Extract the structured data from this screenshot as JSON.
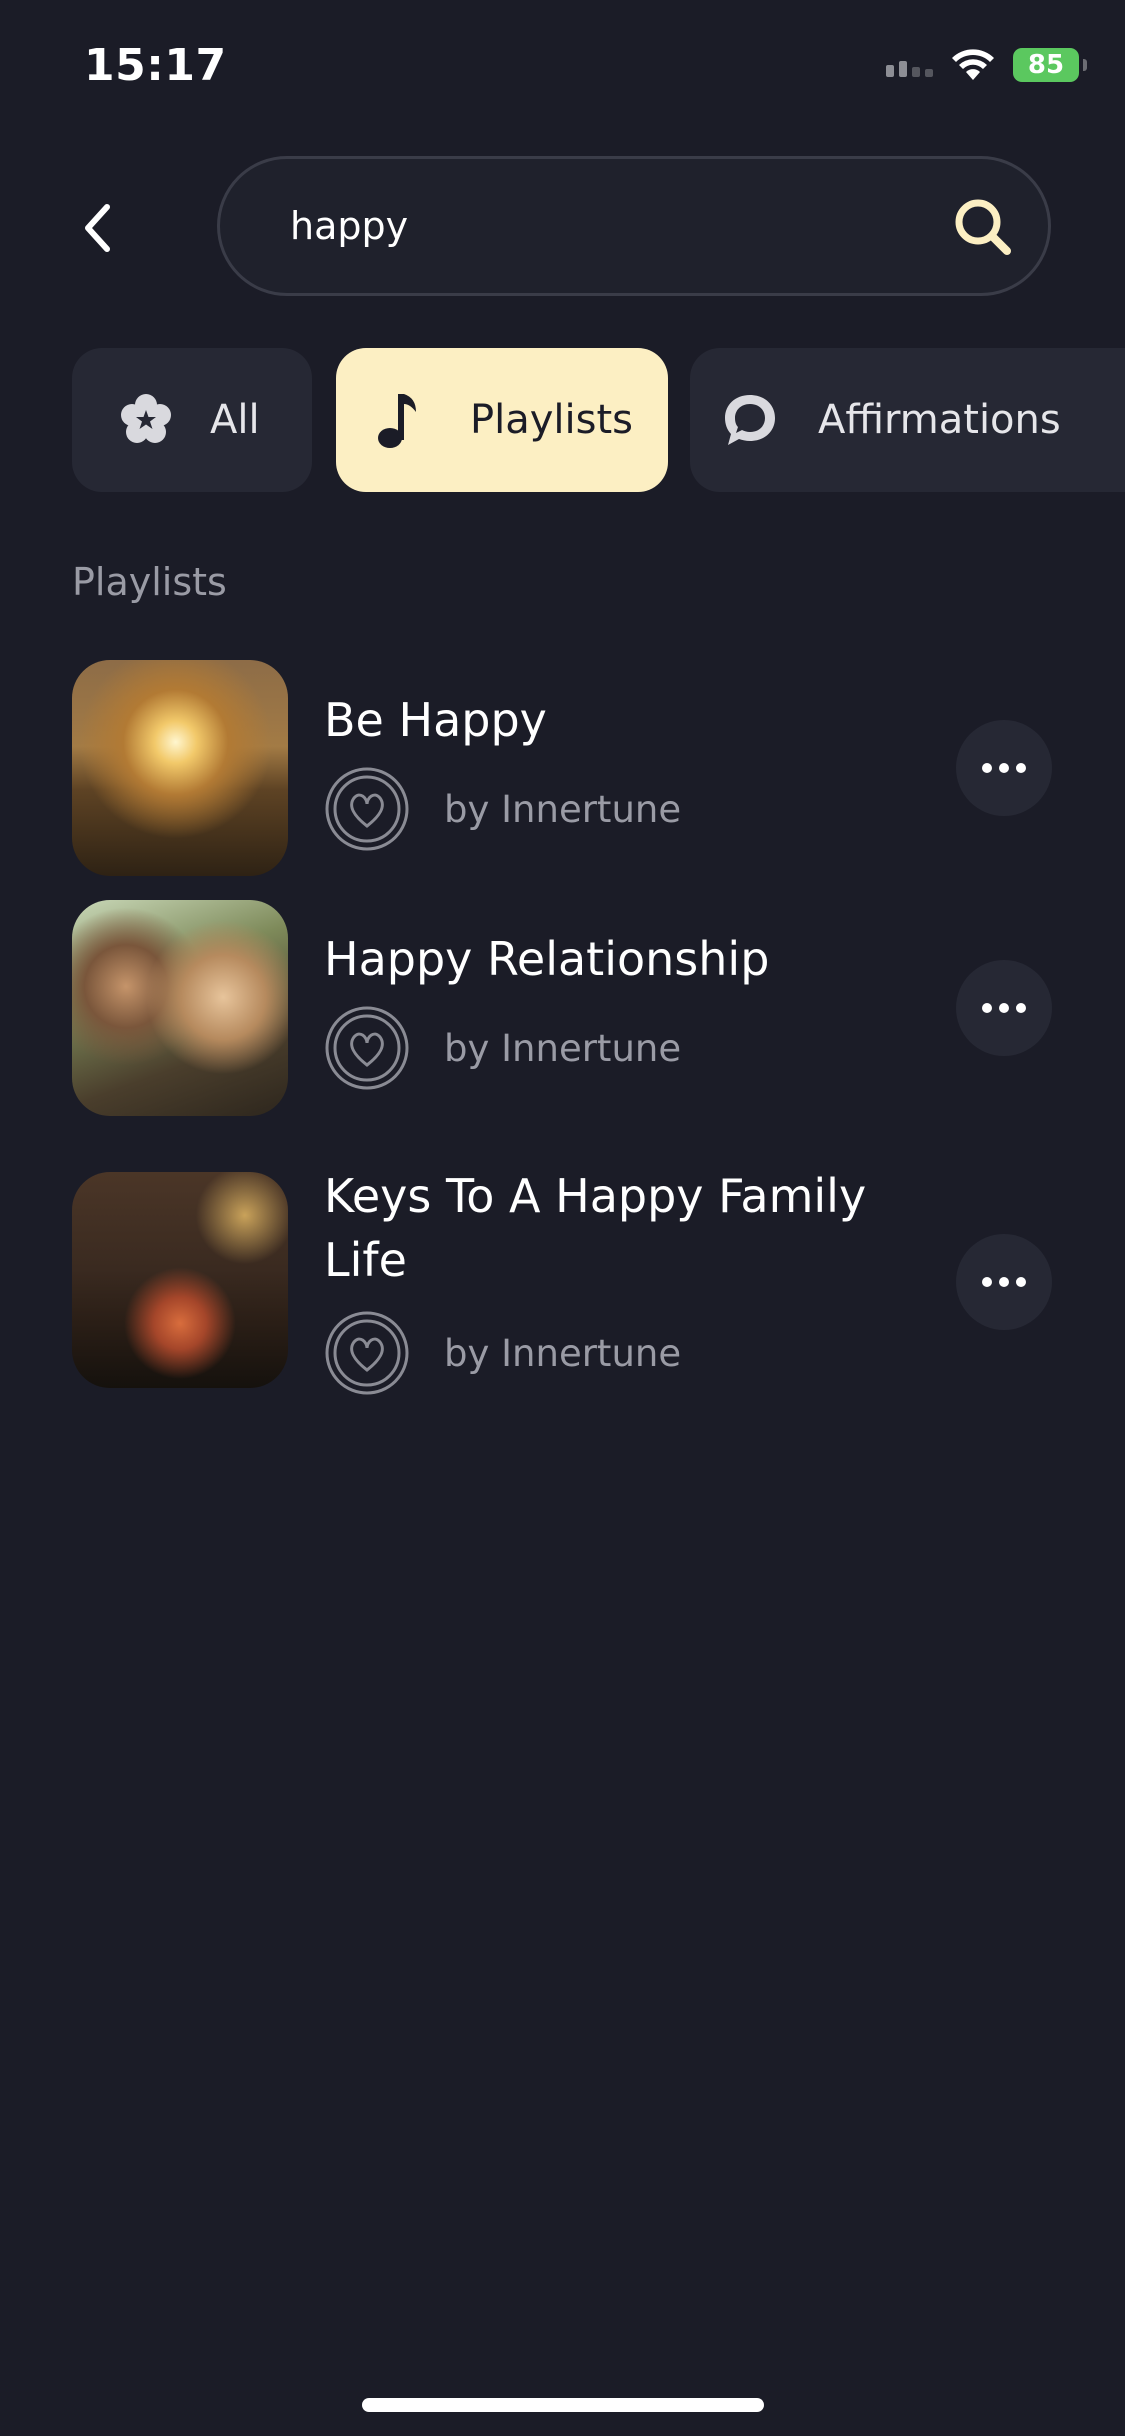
{
  "status_bar": {
    "time": "15:17",
    "battery": "85"
  },
  "header": {
    "back_icon": "chevron-left-icon",
    "search": {
      "value": "happy",
      "icon": "search-icon",
      "icon_color": "#fcefc3"
    }
  },
  "filters": {
    "active": "Playlists",
    "active_color": "#fcefc3",
    "items": [
      {
        "label": "All",
        "icon": "flower-star-icon"
      },
      {
        "label": "Playlists",
        "icon": "music-note-icon"
      },
      {
        "label": "Affirmations",
        "icon": "speech-bubble-icon"
      }
    ]
  },
  "section": {
    "title": "Playlists"
  },
  "playlists": [
    {
      "title": "Be Happy",
      "author": "by Innertune"
    },
    {
      "title": "Happy Relationship",
      "author": "by Innertune"
    },
    {
      "title": "Keys To A Happy Family Life",
      "author": "by Innertune"
    }
  ]
}
